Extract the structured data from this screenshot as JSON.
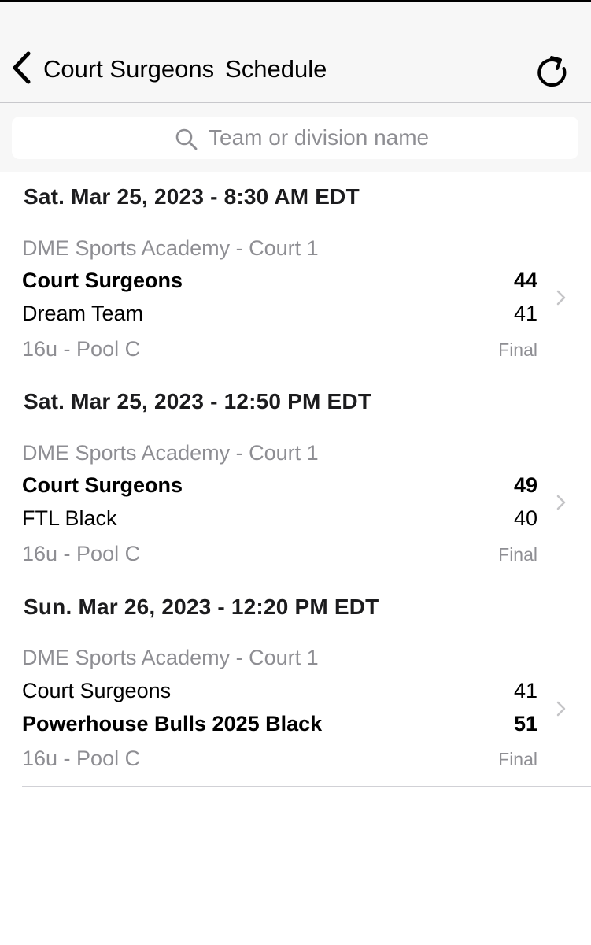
{
  "nav": {
    "title_team": "Court Surgeons",
    "title_page": "Schedule",
    "back_icon": "chevron-left-icon",
    "refresh_icon": "refresh-icon"
  },
  "search": {
    "placeholder": "Team or division name",
    "value": ""
  },
  "games": [
    {
      "datetime": "Sat. Mar 25, 2023 - 8:30 AM EDT",
      "venue": "DME Sports Academy - Court 1",
      "team1": "Court Surgeons",
      "score1": "44",
      "team2": "Dream Team",
      "score2": "41",
      "division": "16u - Pool C",
      "status": "Final"
    },
    {
      "datetime": "Sat. Mar 25, 2023 - 12:50 PM EDT",
      "venue": "DME Sports Academy - Court 1",
      "team1": "Court Surgeons",
      "score1": "49",
      "team2": "FTL Black",
      "score2": "40",
      "division": "16u - Pool C",
      "status": "Final"
    },
    {
      "datetime": "Sun. Mar 26, 2023 - 12:20 PM EDT",
      "venue": "DME Sports Academy - Court 1",
      "team1": "Court Surgeons",
      "score1": "41",
      "team2": "Powerhouse Bulls 2025 Black",
      "score2": "51",
      "division": "16u - Pool C",
      "status": "Final"
    }
  ],
  "colors": {
    "navbar_bg": "#f7f7f7",
    "secondary_text": "#8e8e93",
    "separator": "#c8c8cc"
  }
}
